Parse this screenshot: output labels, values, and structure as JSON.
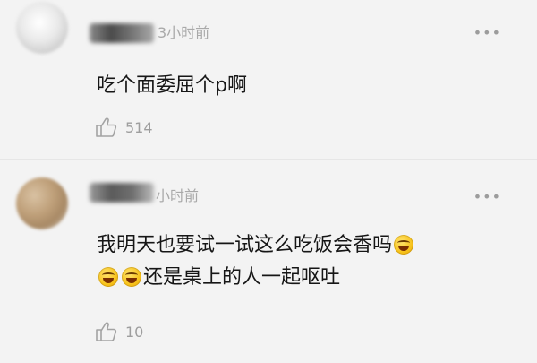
{
  "comments": [
    {
      "time": "3小时前",
      "text_lines": [
        "吃个面委屈个p啊"
      ],
      "likes": "514",
      "more_icon": "more-dots-icon",
      "like_icon": "thumbs-up-icon"
    },
    {
      "time": "小时前",
      "text_lines": [
        "我明天也要试一试这么吃饭会香吗",
        "还是桌上的人一起呕吐"
      ],
      "emojis": [
        "laugh-cry-emoji",
        "laugh-cry-emoji",
        "laugh-cry-emoji"
      ],
      "likes": "10",
      "more_icon": "more-dots-icon",
      "like_icon": "thumbs-up-icon"
    }
  ],
  "more_glyph": "•••"
}
